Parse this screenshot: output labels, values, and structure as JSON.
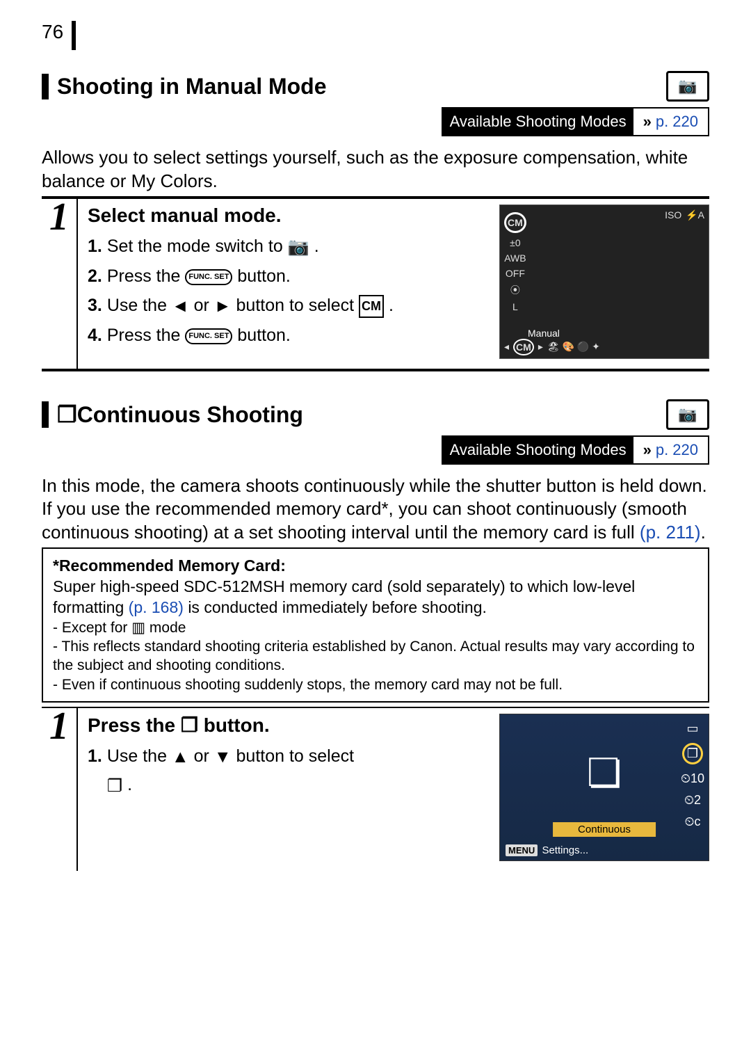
{
  "page_number": "76",
  "section1": {
    "title": "Shooting in Manual Mode",
    "asm_label": "Available Shooting Modes",
    "asm_page": "p. 220",
    "intro": "Allows you to select settings yourself, such as the exposure compensation, white balance or My Colors.",
    "step_num": "1",
    "step_title": "Select manual mode.",
    "sub1_a": "Set the mode switch to ",
    "sub1_b": ".",
    "sub2_a": "Press the ",
    "sub2_b": " button.",
    "sub3_a": "Use the ",
    "sub3_b": " or ",
    "sub3_c": " button to select ",
    "sub3_d": ".",
    "sub4_a": "Press the ",
    "sub4_b": " button.",
    "func_set": "FUNC.\nSET",
    "screen": {
      "cm": "CM",
      "ev": "±0",
      "awb": "AWB",
      "off": "OFF",
      "metering": "⦿",
      "L": "L",
      "manual": "Manual",
      "iso": "ISO",
      "flash": "⚡A"
    }
  },
  "section2": {
    "title_prefix_icon": "❐",
    "title": "Continuous Shooting",
    "asm_label": "Available Shooting Modes",
    "asm_page": "p. 220",
    "intro_a": "In this mode, the camera shoots continuously while the shutter button is held down. If you use the recommended memory card*, you can shoot continuously (smooth continuous shooting) at a set shooting interval until the memory card is full ",
    "intro_link": "(p. 211)",
    "intro_b": ".",
    "note_title": "*Recommended Memory Card:",
    "note_body_a": "Super high-speed SDC-512MSH memory card (sold separately) to which low-level formatting ",
    "note_link": "(p. 168)",
    "note_body_b": " is conducted immediately before shooting.",
    "bullet1_a": "- Except for ",
    "bullet1_b": " mode",
    "bullet2": "- This reflects standard shooting criteria established by Canon. Actual results may vary according to the subject and shooting conditions.",
    "bullet3": "- Even if continuous shooting suddenly stops, the memory card may not be full.",
    "step_num": "1",
    "step_title_a": "Press the ",
    "step_title_b": " button.",
    "sub1_a": "Use the ",
    "sub1_b": " or ",
    "sub1_c": " button to select ",
    "sub1_d": ".",
    "screen": {
      "label": "Continuous",
      "menu_btn": "MENU",
      "menu_txt": "Settings...",
      "c10": "⏲10",
      "c2": "⏲2",
      "cc": "⏲c"
    }
  }
}
